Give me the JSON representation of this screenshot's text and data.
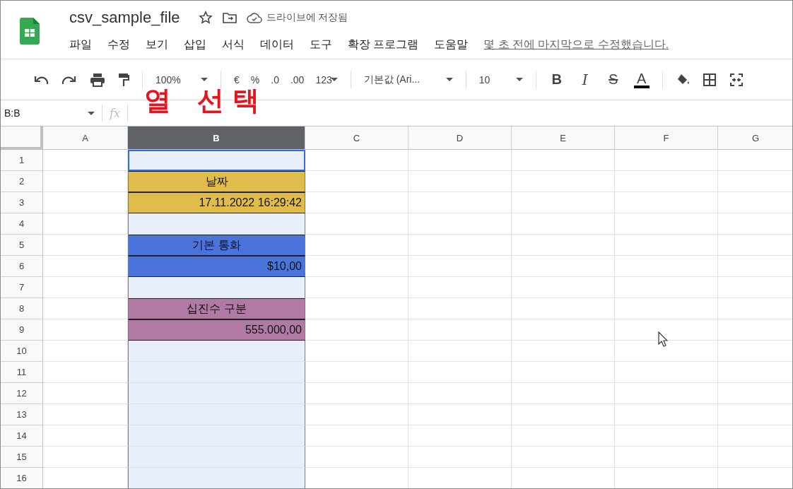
{
  "app": {
    "title": "csv_sample_file",
    "save_status": "드라이브에 저장됨",
    "last_edit": "몇 초 전에 마지막으로 수정했습니다."
  },
  "menu": [
    "파일",
    "수정",
    "보기",
    "삽입",
    "서식",
    "데이터",
    "도구",
    "확장 프로그램",
    "도움말"
  ],
  "toolbar": {
    "zoom": "100%",
    "number_buttons": [
      "€",
      "%",
      ".0",
      ".00",
      "123"
    ],
    "font": "기본값 (Ari...",
    "font_size": "10",
    "format_buttons": [
      {
        "kind": "bold",
        "label": "B"
      },
      {
        "kind": "italic",
        "label": "I"
      },
      {
        "kind": "strike",
        "label": "S"
      },
      {
        "kind": "color",
        "label": "A"
      }
    ]
  },
  "annotation": "열 선택",
  "name_box": "B:B",
  "formula_label": "fx",
  "columns": [
    {
      "label": "A",
      "selected": false
    },
    {
      "label": "B",
      "selected": true
    },
    {
      "label": "C",
      "selected": false
    },
    {
      "label": "D",
      "selected": false
    },
    {
      "label": "E",
      "selected": false
    },
    {
      "label": "F",
      "selected": false
    },
    {
      "label": "G",
      "selected": false
    }
  ],
  "rows": [
    {
      "number": "1",
      "active": true
    },
    {
      "number": "2",
      "active": false,
      "cell": {
        "text": "날짜",
        "kind": "label",
        "color": "#e0bd4a"
      }
    },
    {
      "number": "3",
      "active": false,
      "cell": {
        "text": "17.11.2022 16:29:42",
        "kind": "value",
        "color": "#e0bd4a"
      }
    },
    {
      "number": "4",
      "active": false
    },
    {
      "number": "5",
      "active": false,
      "cell": {
        "text": "기본 통화",
        "kind": "label",
        "color": "#4a74db"
      }
    },
    {
      "number": "6",
      "active": false,
      "cell": {
        "text": "$10,00",
        "kind": "value",
        "color": "#4a74db"
      }
    },
    {
      "number": "7",
      "active": false
    },
    {
      "number": "8",
      "active": false,
      "cell": {
        "text": "십진수 구분",
        "kind": "label",
        "color": "#b07aa4"
      }
    },
    {
      "number": "9",
      "active": false,
      "cell": {
        "text": "555.000,00",
        "kind": "value",
        "color": "#b07aa4"
      }
    },
    {
      "number": "10",
      "active": false
    },
    {
      "number": "11",
      "active": false
    },
    {
      "number": "12",
      "active": false
    },
    {
      "number": "13",
      "active": false
    },
    {
      "number": "14",
      "active": false
    },
    {
      "number": "15",
      "active": false
    },
    {
      "number": "16",
      "active": false
    }
  ]
}
